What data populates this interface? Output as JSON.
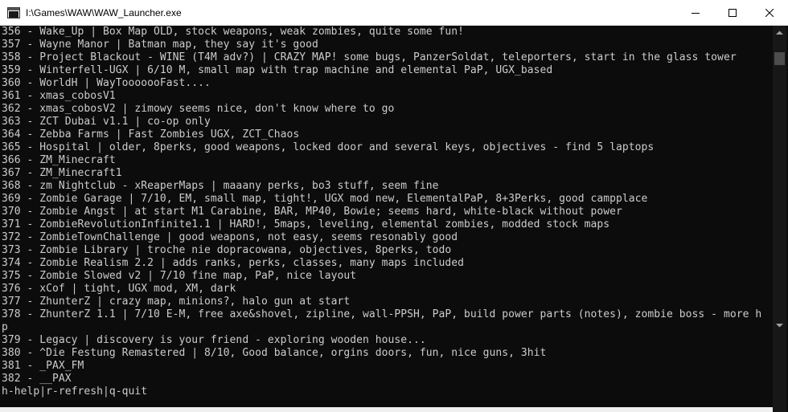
{
  "window": {
    "title": "I:\\Games\\WAW\\WAW_Launcher.exe"
  },
  "console": {
    "lines": [
      "356 - Wake_Up | Box Map OLD, stock weapons, weak zombies, quite some fun!",
      "357 - Wayne Manor | Batman map, they say it's good",
      "358 - Project Blackout - WINE (T4M adv?) | CRAZY MAP! some bugs, PanzerSoldat, teleporters, start in the glass tower",
      "359 - Winterfell-UGX | 6/10 M, small map with trap machine and elemental PaP, UGX_based",
      "360 - WorldH | WayTooooooFast....",
      "361 - xmas_cobosV1",
      "362 - xmas_cobosV2 | zimowy seems nice, don't know where to go",
      "363 - ZCT Dubai v1.1 | co-op only",
      "364 - Zebba Farms | Fast Zombies UGX, ZCT_Chaos",
      "365 - Hospital | older, 8perks, good weapons, locked door and several keys, objectives - find 5 laptops",
      "366 - ZM_Minecraft",
      "367 - ZM_Minecraft1",
      "368 - zm Nightclub - xReaperMaps | maaany perks, bo3 stuff, seem fine",
      "369 - Zombie Garage | 7/10, EM, small map, tight!, UGX mod new, ElementalPaP, 8+3Perks, good campplace",
      "370 - Zombie Angst | at start M1 Carabine, BAR, MP40, Bowie; seems hard, white-black without power",
      "371 - ZombieRevolutionInfinite1.1 | HARD!, 5maps, leveling, elemental zombies, modded stock maps",
      "372 - ZombieTownChallenge | good weapons, not easy, seems resonably good",
      "373 - Zombie Library | troche nie dopracowana, objectives, 8perks, todo",
      "374 - Zombie Realism 2.2 | adds ranks, perks, classes, many maps included",
      "375 - Zombie Slowed v2 | 7/10 fine map, PaP, nice layout",
      "376 - xCof | tight, UGX mod, XM, dark",
      "377 - ZhunterZ | crazy map, minions?, halo gun at start",
      "378 - ZhunterZ 1.1 | 7/10 E-M, free axe&shovel, zipline, wall-PPSH, PaP, build power parts (notes), zombie boss - more h",
      "p",
      "379 - Legacy | discovery is your friend - exploring wooden house...",
      "380 - ^Die Festung Remastered | 8/10, Good balance, orgins doors, fun, nice guns, 3hit",
      "381 - _PAX_FM",
      "382 - __PAX",
      "h-help|r-refresh|q-quit"
    ]
  },
  "colors": {
    "console_bg": "#0c0c0c",
    "console_text": "#cccccc",
    "titlebar_bg": "#ffffff",
    "scrollbar_bg": "#171717",
    "scrollbar_thumb": "#4d4d4d"
  },
  "icons": {
    "app": "console-app-icon",
    "minimize": "minimize-icon",
    "maximize": "maximize-icon",
    "close": "close-icon",
    "scroll_up": "scroll-up-arrow-icon",
    "scroll_down": "scroll-down-arrow-icon"
  }
}
